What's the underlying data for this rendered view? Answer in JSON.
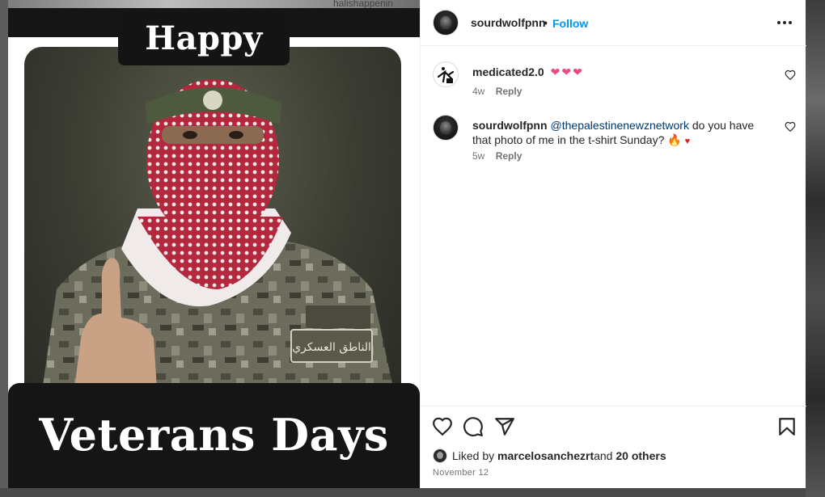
{
  "background": {
    "top_tag": "halishappenin"
  },
  "post_image": {
    "top_text": "Happy",
    "bottom_text": "Veterans Days"
  },
  "header": {
    "username": "sourdwolfpnn",
    "separator": "•",
    "follow_label": "Follow"
  },
  "comments": [
    {
      "username": "medicated2.0",
      "text": "",
      "emoji": "❤❤❤",
      "age": "4w",
      "reply_label": "Reply"
    },
    {
      "username": "sourdwolfpnn",
      "mention": "@thepalestinenewznetwork",
      "text_before": " do you have that photo of me in the t-shirt Sunday? ",
      "emoji_fire": "🔥",
      "emoji_heart": "♥",
      "age": "5w",
      "reply_label": "Reply"
    }
  ],
  "footer": {
    "liked_by_prefix": "Liked by ",
    "liked_by_user": "marcelosanchezrt",
    "liked_by_and": " and ",
    "liked_by_others": "20 others",
    "date": "November 12"
  },
  "colors": {
    "accent": "#0095f6",
    "text": "#262626",
    "muted": "#737373",
    "mention": "#00376b"
  }
}
